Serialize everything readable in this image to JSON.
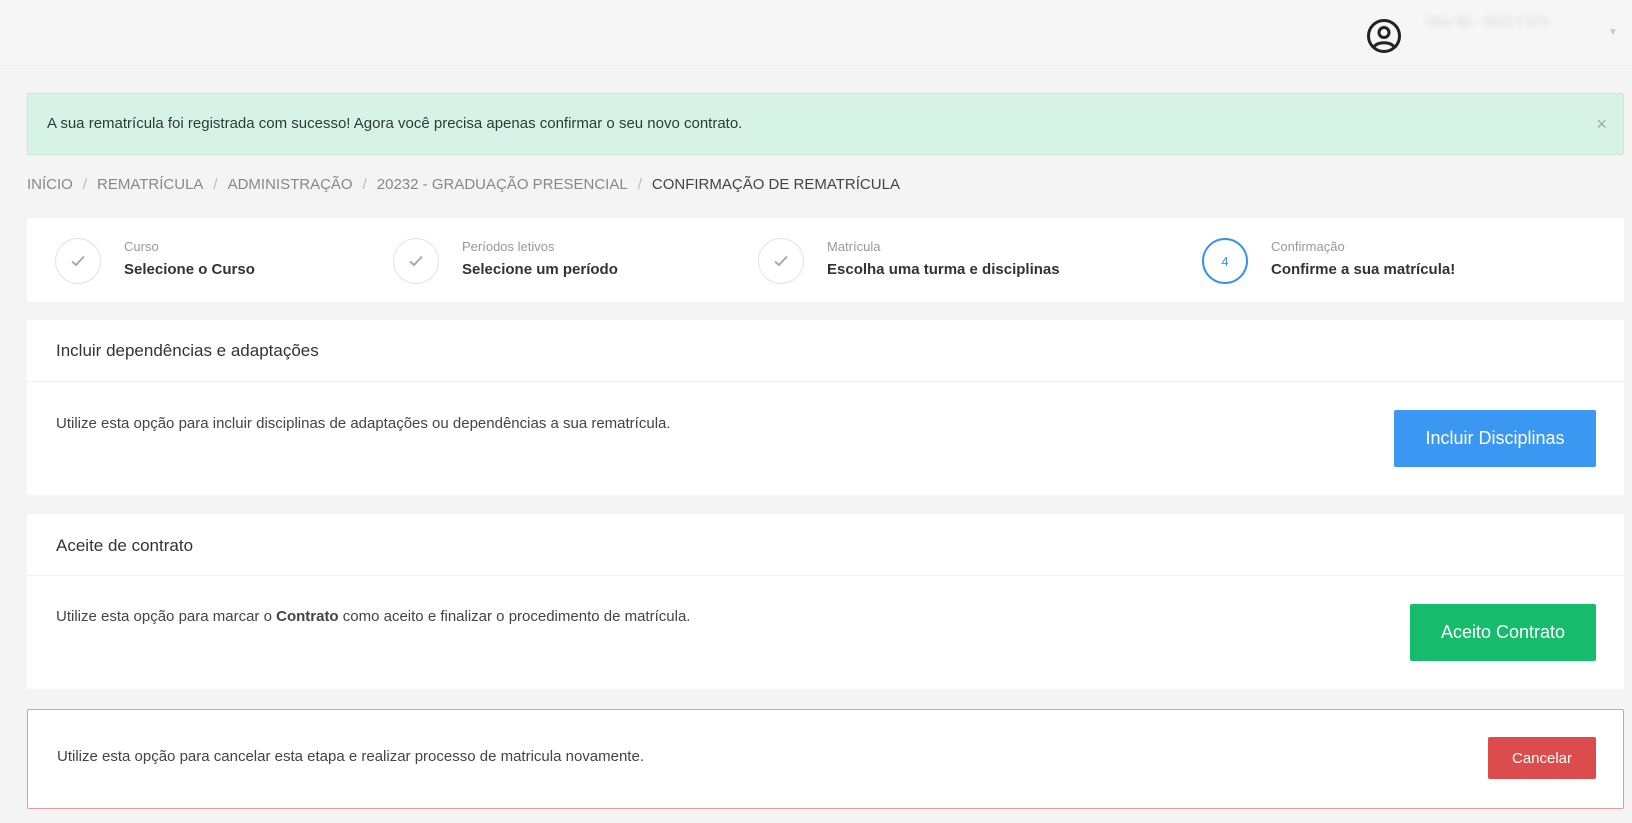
{
  "header": {
    "user_name": "Vitor Bo - 2023 1 974",
    "user_icon": "user-circle-icon",
    "caret_icon": "chevron-down-icon"
  },
  "alert": {
    "message": "A sua rematrícula foi registrada com sucesso! Agora você precisa apenas confirmar o seu novo contrato.",
    "close_label": "×",
    "color": "#d7f3e8"
  },
  "breadcrumb": {
    "items": [
      "INÍCIO",
      "REMATRÍCULA",
      "ADMINISTRAÇÃO",
      "20232 - GRADUAÇÃO PRESENCIAL"
    ],
    "current": "CONFIRMAÇÃO DE REMATRÍCULA",
    "separator": "/"
  },
  "steps": [
    {
      "title": "Curso",
      "subtitle": "Selecione o Curso",
      "state": "done",
      "icon": "check-icon"
    },
    {
      "title": "Períodos letivos",
      "subtitle": "Selecione um período",
      "state": "done",
      "icon": "check-icon"
    },
    {
      "title": "Matrícula",
      "subtitle": "Escolha uma turma e disciplinas",
      "state": "done",
      "icon": "check-icon"
    },
    {
      "title": "Confirmação",
      "subtitle": "Confirme a sua matrícula!",
      "state": "active",
      "number": "4"
    }
  ],
  "dependencias": {
    "title": "Incluir dependências e adaptações",
    "text": "Utilize esta opção para incluir disciplinas de adaptações ou dependências a sua rematrícula.",
    "button_label": "Incluir Disciplinas"
  },
  "contrato": {
    "title": "Aceite de contrato",
    "text_before": "Utilize esta opção para marcar o ",
    "text_bold": "Contrato",
    "text_after": " como aceito e finalizar o procedimento de matrícula.",
    "button_label": "Aceito Contrato"
  },
  "cancelar": {
    "text": "Utilize esta opção para cancelar esta etapa e realizar processo de matricula novamente.",
    "button_label": "Cancelar"
  },
  "colors": {
    "primary": "#3a97f2",
    "success": "#16bc6c",
    "danger": "#dc4c4c",
    "step_active": "#3a91ea"
  }
}
